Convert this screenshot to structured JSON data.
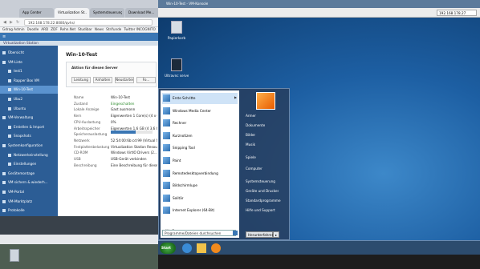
{
  "browser": {
    "tabs": [
      {
        "label": "App Center",
        "active": false
      },
      {
        "label": "Virtualization St...",
        "active": true
      },
      {
        "label": "Systemsteuerung...",
        "active": false
      },
      {
        "label": "Download Me...",
        "active": false
      }
    ],
    "url": "192.168.178.22:8080/qvhs/",
    "bookmarks": [
      "Gdrag Admin",
      "Doodle",
      "ARD",
      "ZDF",
      "Rehn.Net",
      "Studibar",
      "News",
      "Strifunde",
      "Twitter INCOGNITO"
    ]
  },
  "qnap": {
    "app_title": "Virtualization Station",
    "sidebar": [
      {
        "label": "Übersicht",
        "level": 0,
        "active": false
      },
      {
        "label": "VM-Liste",
        "level": 0,
        "active": false
      },
      {
        "label": "test1",
        "level": 1,
        "active": false
      },
      {
        "label": "Rapper Box VM",
        "level": 1,
        "active": false
      },
      {
        "label": "Win-10-Test",
        "level": 1,
        "active": true
      },
      {
        "label": "Ubu2",
        "level": 1,
        "active": false
      },
      {
        "label": "Ubuntu",
        "level": 1,
        "active": false
      },
      {
        "label": "VM-Verwaltung",
        "level": 0,
        "active": false
      },
      {
        "label": "Erstellen & Import",
        "level": 1,
        "active": false
      },
      {
        "label": "Snapshots",
        "level": 1,
        "active": false
      },
      {
        "label": "Systemkonfiguration",
        "level": 0,
        "active": false
      },
      {
        "label": "Netzwerkeinstellung",
        "level": 1,
        "active": false
      },
      {
        "label": "Einstellungen",
        "level": 1,
        "active": false
      },
      {
        "label": "Gerätemontage",
        "level": 0,
        "active": false
      },
      {
        "label": "VM sichern & wiederh...",
        "level": 0,
        "active": false
      },
      {
        "label": "VM-Portal",
        "level": 0,
        "active": false
      },
      {
        "label": "VM-Marktplatz",
        "level": 0,
        "active": false
      },
      {
        "label": "Protokolle",
        "level": 0,
        "active": false
      }
    ],
    "vm_title": "Win-10-Test",
    "server_title": "Aktion für diesen Server",
    "actions": [
      "Leistung",
      "Anhalten",
      "Neustarten",
      "Fo..."
    ],
    "props": [
      {
        "key": "Name",
        "value": "Win-10-Test"
      },
      {
        "key": "Zustand",
        "value": "Eingeschalten"
      },
      {
        "key": "Lokale Anzeige",
        "value": "Gast ausmonn"
      },
      {
        "key": "Kern",
        "value": "Eigenwerten 1 Core(s) (4 x C..."
      },
      {
        "key": "CPU-Auslastung",
        "value": "0%"
      },
      {
        "key": "Arbeitsspeicher",
        "value": "Eigenwerten 1,6 GB (4 3,6 GB)"
      },
      {
        "key": "Speicherauslastung",
        "value": ""
      },
      {
        "key": "Netzwerk",
        "value": "52:54:00:6b:cd:99 (Virtual S..."
      },
      {
        "key": "Festplattenbelastung",
        "value": "Virtualization Station Resource..."
      },
      {
        "key": "CD-ROM",
        "value": "Windows VirtIO Drivers (2..."
      },
      {
        "key": "USB",
        "value": "USB-Gerät verbinden"
      },
      {
        "key": "Beschreibung",
        "value": "Eine Beschreibung für diese..."
      }
    ]
  },
  "vm": {
    "title": "Win-10-Test - VM-Konsole",
    "ip": "192.168.178.27",
    "desktop_icons": [
      {
        "label": "Papierkorb"
      },
      {
        "label": "Ultravnc server"
      }
    ],
    "start_left": [
      {
        "label": "Erste Schritte",
        "arrow": true
      },
      {
        "label": "Windows Media Center",
        "arrow": false
      },
      {
        "label": "Rechner",
        "arrow": false
      },
      {
        "label": "Kurznotizen",
        "arrow": false
      },
      {
        "label": "Snipping Tool",
        "arrow": false
      },
      {
        "label": "Paint",
        "arrow": false
      },
      {
        "label": "Remotedesktopverbindung",
        "arrow": false
      },
      {
        "label": "Bildschirmlupe",
        "arrow": false
      },
      {
        "label": "Solitär",
        "arrow": false
      },
      {
        "label": "Internet Explorer (64-Bit)",
        "arrow": false
      }
    ],
    "all_programs": "Alle Programme",
    "search_placeholder": "Programme/Dateien durchsuchen",
    "start_right": [
      "Armer",
      "Dokumente",
      "Bilder",
      "Musik",
      "Spiele",
      "Computer",
      "Systemsteuerung",
      "Geräte und Drucker",
      "Standardprogramme",
      "Hilfe und Support"
    ],
    "shutdown_label": "Herunterfahren",
    "start_label": "Start"
  },
  "colors": {
    "qnap_blue": "#3a76b4",
    "qnap_sidebar": "#2c5d95",
    "win_desktop": "#1d5fa3",
    "taskbar": "#2c4c6e"
  }
}
